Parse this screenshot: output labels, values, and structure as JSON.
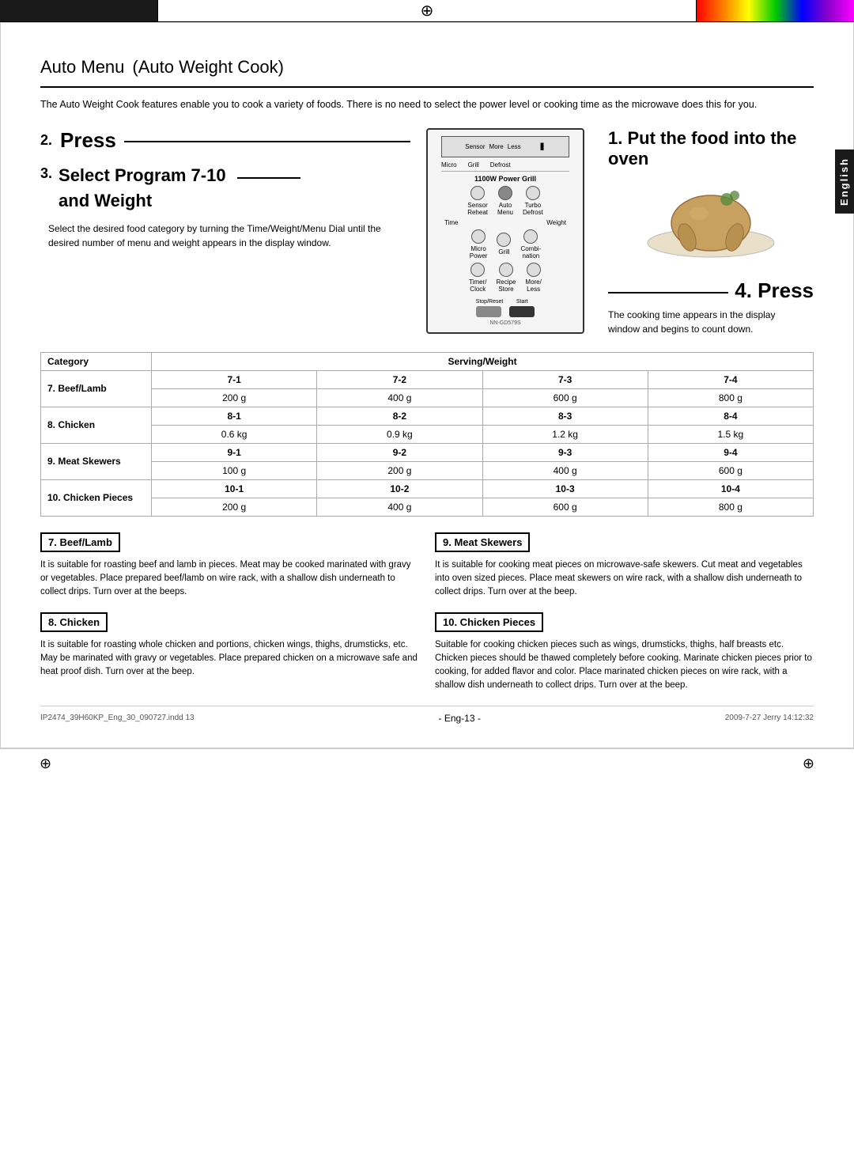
{
  "page": {
    "top_bar_compass": "⊕",
    "top_bar_compass2": "⊕",
    "language_tab": "English"
  },
  "title": {
    "main": "Auto Menu",
    "subtitle": "(Auto Weight Cook)"
  },
  "intro": "The Auto Weight Cook features enable you to cook a variety of foods. There is no need to select the power level or cooking time as the microwave does this for you.",
  "steps": {
    "step1": {
      "number": "1.",
      "label": "Put the food into the oven"
    },
    "step2": {
      "number": "2.",
      "label": "Press"
    },
    "step3": {
      "number": "3.",
      "label": "Select Program 7-10",
      "sublabel": "and Weight",
      "description": "Select the desired food category by turning the Time/Weight/Menu Dial until the desired number of menu and weight appears in the display window."
    },
    "step4": {
      "number": "4.",
      "label": "Press",
      "description1": "The cooking time appears in the display",
      "description2": "window and begins to count down."
    }
  },
  "microwave": {
    "label": "1100W Power Grill",
    "display_labels": [
      "Sensor",
      "More",
      "Less"
    ],
    "tabs": [
      "Micro",
      "Grill",
      "Defrost"
    ],
    "buttons_row1": [
      "Sensor Reheat",
      "Auto Menu",
      "Turbo Defrost"
    ],
    "time_label": "Time",
    "weight_label": "Weight",
    "buttons_row2": [
      "Micro Power",
      "Grill",
      "Combination"
    ],
    "buttons_row3": [
      "Timer/ Clock",
      "Recipe Store",
      "More/ Less"
    ],
    "stop_reset": "Stop/Reset",
    "start": "Start",
    "model": "NN-GD579S"
  },
  "table": {
    "col_header": "Category",
    "serving_weight_header": "Serving/Weight",
    "rows": [
      {
        "category": "7. Beef/Lamb",
        "codes": [
          "7-1",
          "7-2",
          "7-3",
          "7-4"
        ],
        "weights": [
          "200 g",
          "400 g",
          "600 g",
          "800 g"
        ]
      },
      {
        "category": "8. Chicken",
        "codes": [
          "8-1",
          "8-2",
          "8-3",
          "8-4"
        ],
        "weights": [
          "0.6 kg",
          "0.9 kg",
          "1.2 kg",
          "1.5 kg"
        ]
      },
      {
        "category": "9. Meat Skewers",
        "codes": [
          "9-1",
          "9-2",
          "9-3",
          "9-4"
        ],
        "weights": [
          "100 g",
          "200 g",
          "400 g",
          "600 g"
        ]
      },
      {
        "category": "10. Chicken Pieces",
        "codes": [
          "10-1",
          "10-2",
          "10-3",
          "10-4"
        ],
        "weights": [
          "200 g",
          "400 g",
          "600 g",
          "800 g"
        ]
      }
    ]
  },
  "descriptions": {
    "beef_lamb": {
      "title": "7. Beef/Lamb",
      "text": "It is suitable for roasting beef and lamb in pieces. Meat may be cooked marinated with gravy or vegetables. Place prepared beef/lamb on wire rack, with a shallow dish underneath to collect drips. Turn over at the beeps."
    },
    "chicken": {
      "title": "8. Chicken",
      "text": "It is suitable for roasting whole chicken and portions, chicken wings, thighs, drumsticks, etc. May be marinated with gravy or vegetables. Place prepared chicken on a microwave safe and heat proof dish. Turn over at the beep."
    },
    "meat_skewers": {
      "title": "9. Meat Skewers",
      "text": "It is suitable for cooking meat pieces on microwave-safe skewers. Cut meat and vegetables into oven sized pieces. Place meat skewers on wire rack, with a shallow dish underneath to collect drips. Turn over at the beep."
    },
    "chicken_pieces": {
      "title": "10. Chicken Pieces",
      "text": "Suitable for cooking chicken pieces such as wings, drumsticks, thighs, half breasts etc. Chicken pieces should be thawed completely before cooking. Marinate chicken pieces prior to cooking, for added flavor and color. Place marinated chicken pieces on wire rack, with a shallow dish underneath to collect drips. Turn over at the beep."
    }
  },
  "footer": {
    "left": "IP2474_39H60KP_Eng_30_090727.indd   13",
    "center": "- Eng-13 -",
    "right": "2009-7-27   Jerry 14:12:32"
  }
}
